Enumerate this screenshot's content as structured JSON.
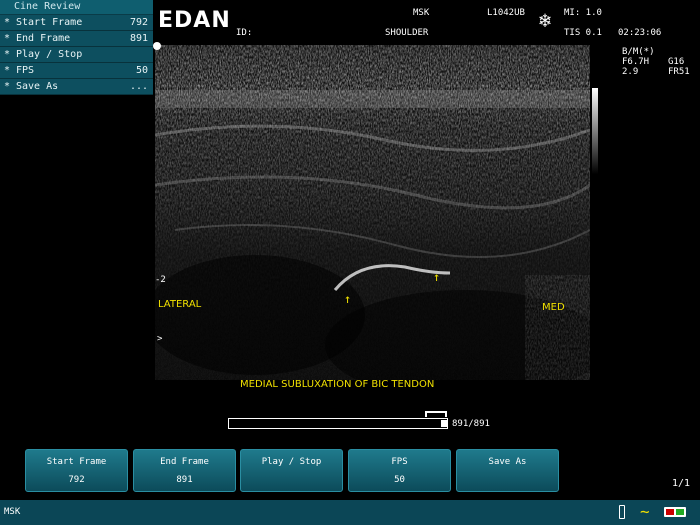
{
  "cine_menu": {
    "title": "Cine Review",
    "items": [
      {
        "label": "Start Frame",
        "value": "792"
      },
      {
        "label": "End Frame",
        "value": "891"
      },
      {
        "label": "Play / Stop",
        "value": ""
      },
      {
        "label": "FPS",
        "value": "50"
      },
      {
        "label": "Save As",
        "value": "..."
      }
    ],
    "bullet": "*"
  },
  "header": {
    "logo": "EDAN",
    "id_label": "ID:",
    "exam": "MSK",
    "preset": "SHOULDER",
    "probe": "L1042UB",
    "mi": "MI: 1.0",
    "tis": "TIS 0.1",
    "time": "02:23:06"
  },
  "image_info": {
    "mode": "B/M(*)",
    "freq": "F6.7H",
    "gain": "G16",
    "depth": "2.9",
    "frame_rate": "FR51"
  },
  "image": {
    "depth_marker": "2",
    "lateral": "LATERAL",
    "medial": "MED",
    "annotation": "MEDIAL SUBLUXATION OF BIC TENDON",
    "pointer": ">",
    "arrow_glyph": "↑"
  },
  "scrub": {
    "counter": "891/891",
    "progress": 1.0
  },
  "softkeys": [
    {
      "label": "Start Frame",
      "value": "792"
    },
    {
      "label": "End Frame",
      "value": "891"
    },
    {
      "label": "Play / Stop",
      "value": ""
    },
    {
      "label": "FPS",
      "value": "50"
    },
    {
      "label": "Save As",
      "value": ""
    }
  ],
  "page_indicator": "1/1",
  "status_bar": {
    "mode": "MSK"
  },
  "icons": {
    "freeze": "snowflake-icon",
    "usb": "usb-icon",
    "ecg": "wave-icon",
    "battery": "battery-icon"
  },
  "colors": {
    "annotation": "#f0e000",
    "panel": "#0d4f5f",
    "softkey": "#1f7a8c"
  }
}
